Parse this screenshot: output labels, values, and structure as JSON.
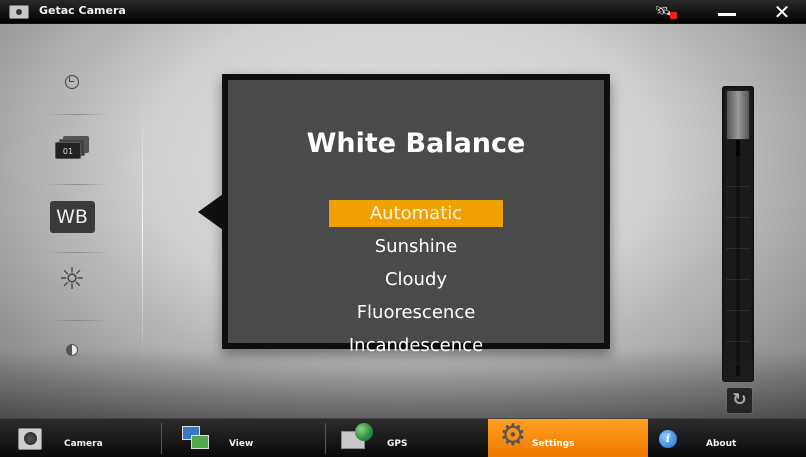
{
  "window": {
    "title": "Getac Camera",
    "controls": {
      "signal_icon": "satellite-signal-icon",
      "minimize": "—",
      "close": "✕"
    }
  },
  "left_toolbar": {
    "items": [
      {
        "name": "self-timer",
        "icon": "timer-icon"
      },
      {
        "name": "burst-mode",
        "icon": "burst-icon",
        "label": "01"
      },
      {
        "name": "white-balance",
        "icon": "wb-icon",
        "label": "WB"
      },
      {
        "name": "brightness",
        "icon": "sun-icon",
        "label": "☼"
      },
      {
        "name": "contrast",
        "icon": "contrast-icon"
      }
    ]
  },
  "white_balance_panel": {
    "title": "White Balance",
    "options": [
      "Automatic",
      "Sunshine",
      "Cloudy",
      "Fluorescence",
      "Incandescence"
    ],
    "selected": "Automatic"
  },
  "zoom_slider": {
    "level": 1.0,
    "reset_label": "↻"
  },
  "taskbar": {
    "items": [
      {
        "label": "Camera",
        "icon": "camera-icon",
        "active": false
      },
      {
        "label": "View",
        "icon": "view-icon",
        "active": false
      },
      {
        "label": "GPS",
        "icon": "gps-icon",
        "active": false
      },
      {
        "label": "Settings",
        "icon": "settings-icon",
        "active": true
      },
      {
        "label": "About",
        "icon": "about-icon",
        "active": false
      }
    ],
    "about_glyph": "i",
    "settings_glyph": "⚙"
  },
  "colors": {
    "active_tab": "#f08c00",
    "selected_option": "#f0a000",
    "panel_bg": "#4a4a4a"
  }
}
